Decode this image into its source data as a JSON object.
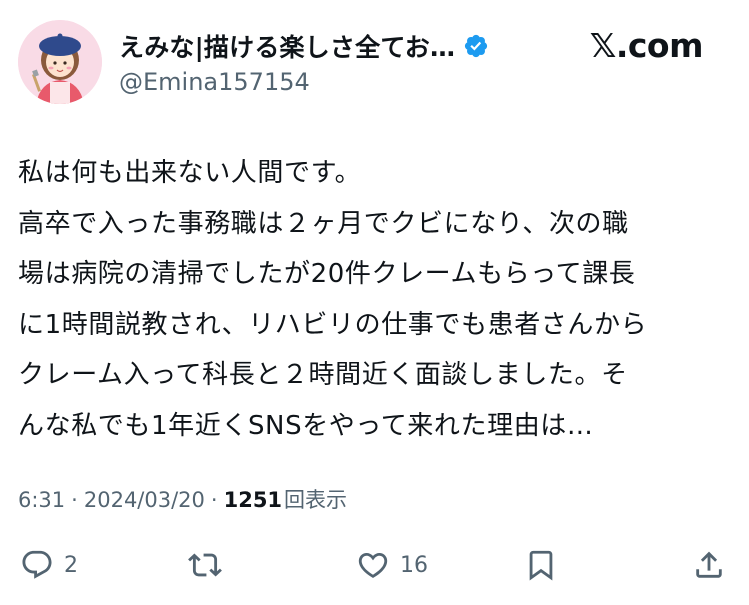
{
  "header": {
    "display_name": "えみな|描ける楽しさ全てお…",
    "handle": "@Emina157154",
    "brand": "𝕏.com",
    "verified_icon": "verified-badge-icon",
    "verified_color": "#1d9bf0"
  },
  "tweet": {
    "lines": [
      "私は何も出来ない人間です。",
      "高卒で入った事務職は２ヶ月でクビになり、次の職",
      "場は病院の清掃でしたが20件クレームもらって課長",
      "に1時間説教され、リハビリの仕事でも患者さんから",
      "クレーム入って科長と２時間近く面談しました。そ",
      "んな私でも1年近くSNSをやって来れた理由は…"
    ]
  },
  "meta": {
    "time": "6:31",
    "separator": "·",
    "date": "2024/03/20",
    "views_count": "1251",
    "views_label": "回表示"
  },
  "actions": {
    "reply_count": "2",
    "retweet_count": "",
    "like_count": "16",
    "icons": [
      "reply-icon",
      "retweet-icon",
      "like-icon",
      "bookmark-icon",
      "share-icon"
    ]
  },
  "colors": {
    "text_primary": "#0f1419",
    "text_secondary": "#536471",
    "accent": "#1d9bf0"
  }
}
